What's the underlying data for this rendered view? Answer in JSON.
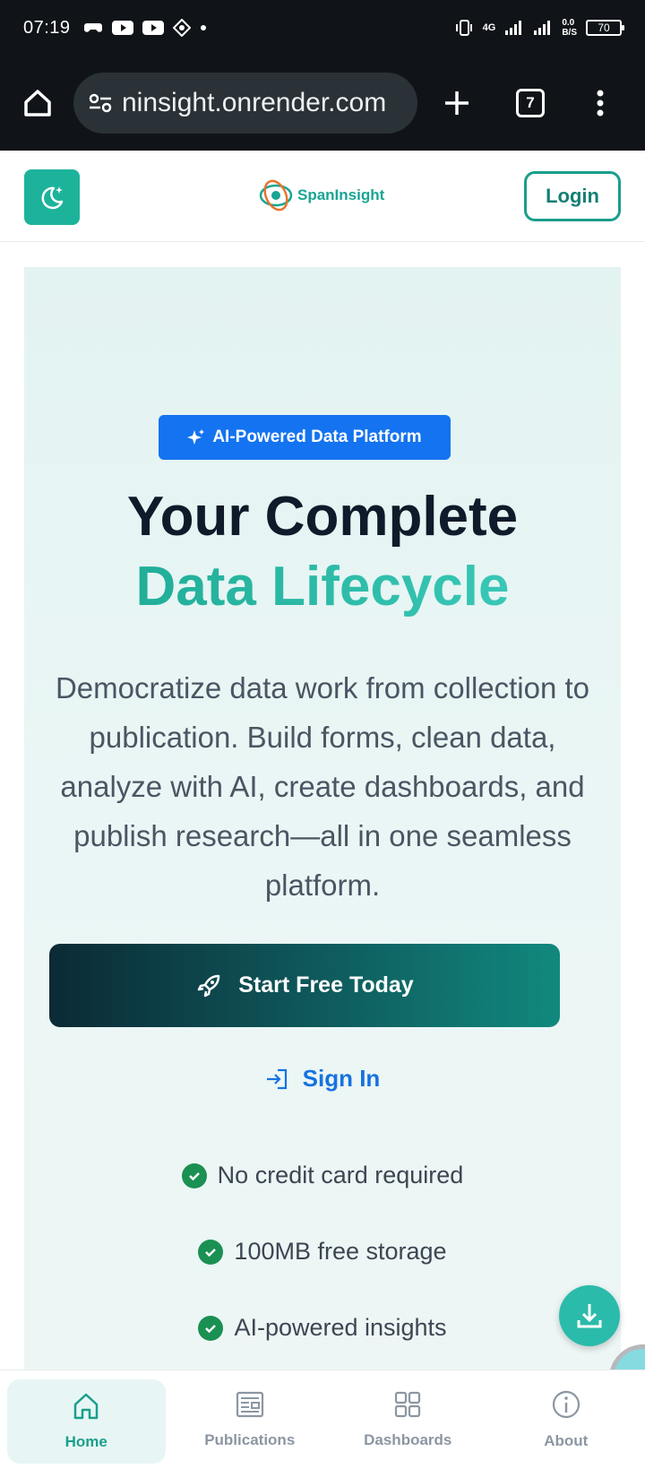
{
  "status_bar": {
    "time": "07:19",
    "net_speed_top": "0.0",
    "net_speed_bottom": "B/S",
    "network": "4G",
    "battery": "70"
  },
  "browser": {
    "url": "ninsight.onrender.com",
    "tab_count": "7"
  },
  "header": {
    "logo_text": "SpanInsight",
    "login_label": "Login"
  },
  "hero": {
    "badge": "AI-Powered Data Platform",
    "title_line1": "Your Complete",
    "title_line2": "Data Lifecycle",
    "description": "Democratize data work from collection to publication. Build forms, clean data, analyze with AI, create dashboards, and publish research—all in one seamless platform.",
    "start_button": "Start Free Today",
    "signin_link": "Sign In",
    "features": [
      "No credit card required",
      "100MB free storage",
      "AI-powered insights"
    ]
  },
  "bottom_nav": {
    "items": [
      {
        "label": "Home"
      },
      {
        "label": "Publications"
      },
      {
        "label": "Dashboards"
      },
      {
        "label": "About"
      }
    ]
  },
  "colors": {
    "brand_teal": "#1db39b",
    "badge_blue": "#1473f0",
    "link_blue": "#1673e0",
    "check_green": "#1a9053"
  }
}
